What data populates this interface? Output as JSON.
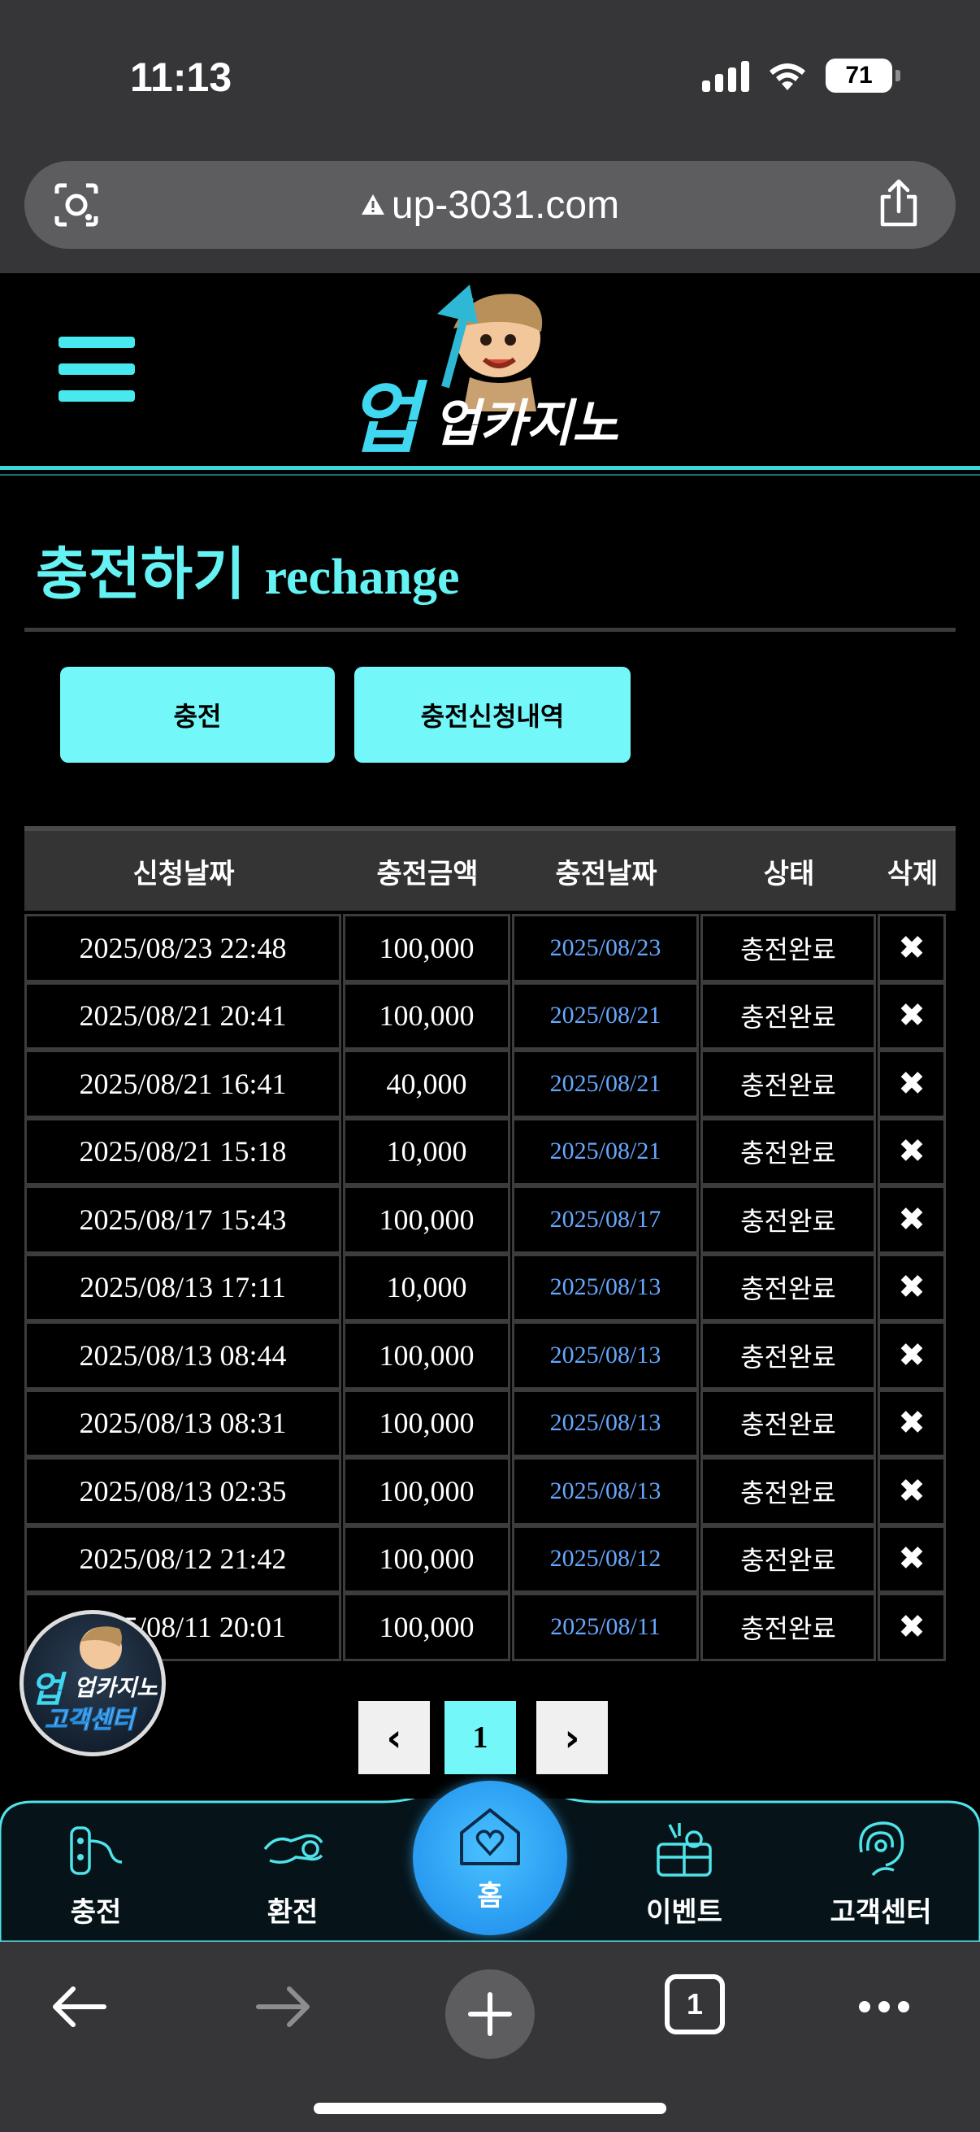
{
  "status_bar": {
    "time": "11:13",
    "battery": "71"
  },
  "browser": {
    "url": "up-3031.com"
  },
  "site": {
    "logo_text": "업카지노"
  },
  "page": {
    "title_ko": "충전하기",
    "title_en": "rechange"
  },
  "buttons": {
    "charge": "충전",
    "history": "충전신청내역"
  },
  "table": {
    "headers": [
      "신청날짜",
      "충전금액",
      "충전날짜",
      "상태",
      "삭제"
    ],
    "rows": [
      {
        "requested": "2025/08/23 22:48",
        "amount": "100,000",
        "charged": "2025/08/23",
        "status": "충전완료",
        "delete": "✖"
      },
      {
        "requested": "2025/08/21 20:41",
        "amount": "100,000",
        "charged": "2025/08/21",
        "status": "충전완료",
        "delete": "✖"
      },
      {
        "requested": "2025/08/21 16:41",
        "amount": "40,000",
        "charged": "2025/08/21",
        "status": "충전완료",
        "delete": "✖"
      },
      {
        "requested": "2025/08/21 15:18",
        "amount": "10,000",
        "charged": "2025/08/21",
        "status": "충전완료",
        "delete": "✖"
      },
      {
        "requested": "2025/08/17 15:43",
        "amount": "100,000",
        "charged": "2025/08/17",
        "status": "충전완료",
        "delete": "✖"
      },
      {
        "requested": "2025/08/13 17:11",
        "amount": "10,000",
        "charged": "2025/08/13",
        "status": "충전완료",
        "delete": "✖"
      },
      {
        "requested": "2025/08/13 08:44",
        "amount": "100,000",
        "charged": "2025/08/13",
        "status": "충전완료",
        "delete": "✖"
      },
      {
        "requested": "2025/08/13 08:31",
        "amount": "100,000",
        "charged": "2025/08/13",
        "status": "충전완료",
        "delete": "✖"
      },
      {
        "requested": "2025/08/13 02:35",
        "amount": "100,000",
        "charged": "2025/08/13",
        "status": "충전완료",
        "delete": "✖"
      },
      {
        "requested": "2025/08/12 21:42",
        "amount": "100,000",
        "charged": "2025/08/12",
        "status": "충전완료",
        "delete": "✖"
      },
      {
        "requested": "2025/08/11 20:01",
        "amount": "100,000",
        "charged": "2025/08/11",
        "status": "충전완료",
        "delete": "✖"
      }
    ]
  },
  "pagination": {
    "prev": "‹",
    "current": "1",
    "next": "›"
  },
  "support_badge": {
    "text_top": "업카지노",
    "text_bottom": "고객센터"
  },
  "bottom_nav": {
    "items": [
      {
        "label": "충전",
        "icon": "charge-icon"
      },
      {
        "label": "환전",
        "icon": "exchange-icon"
      },
      {
        "label": "홈",
        "icon": "home-heart-icon"
      },
      {
        "label": "이벤트",
        "icon": "gift-icon"
      },
      {
        "label": "고객센터",
        "icon": "support-icon"
      }
    ]
  },
  "browser_toolbar": {
    "tab_count": "1"
  },
  "colors": {
    "accent": "#74f7f8",
    "title": "#65f2f3",
    "date_link": "#66a8ff",
    "home_button": "#1a88ea"
  }
}
